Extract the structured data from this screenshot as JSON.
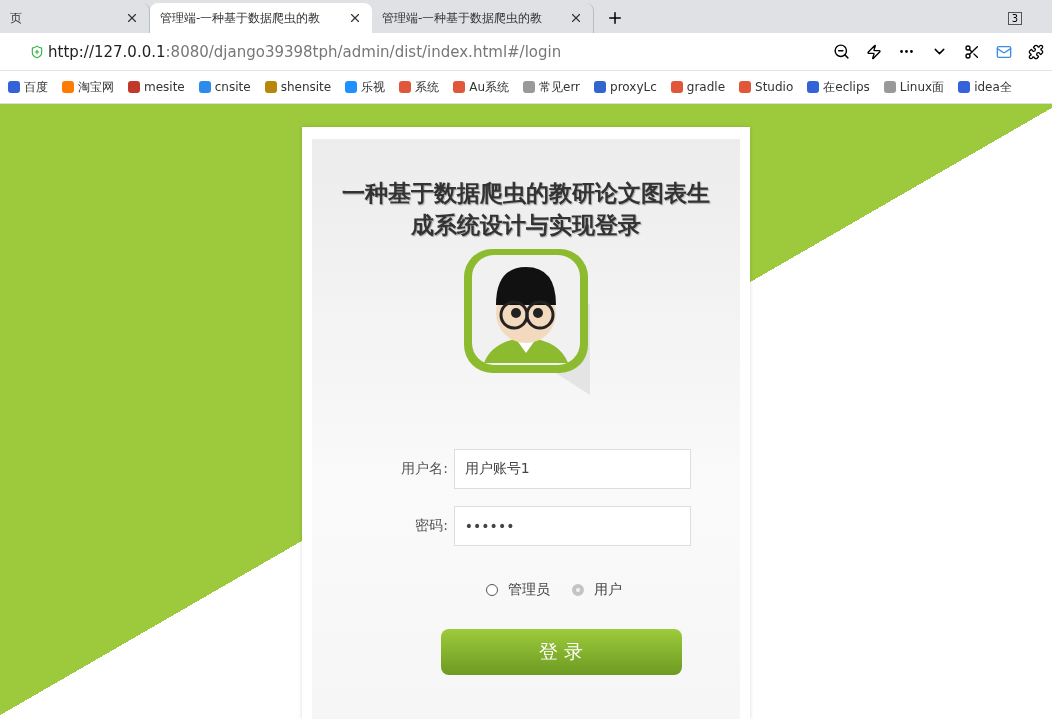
{
  "browser": {
    "tabs": [
      {
        "title": "页",
        "selected": false
      },
      {
        "title": "管理端-一种基于数据爬虫的教",
        "selected": true
      },
      {
        "title": "管理端-一种基于数据爬虫的教",
        "selected": false
      }
    ],
    "tab_count": "3",
    "url_host": "http://127.0.0.1",
    "url_rest": ":8080/django39398tph/admin/dist/index.html#/login",
    "bookmarks": [
      "百度",
      "淘宝网",
      "mesite",
      "cnsite",
      "shensite",
      "乐视",
      "系统",
      "Au系统",
      "常见err",
      "proxyLc",
      "gradle",
      "Studio",
      "在eclips",
      "Linux面",
      "idea全"
    ]
  },
  "login": {
    "title": "一种基于数据爬虫的教研论文图表生成系统设计与实现登录",
    "fields": [
      {
        "label": "用户名:",
        "value": "用户账号1"
      },
      {
        "label": "密码:",
        "value": "••••••"
      }
    ],
    "roles": [
      {
        "label": "管理员",
        "selected": false
      },
      {
        "label": "用户",
        "selected": true
      }
    ],
    "submit": "登 录"
  }
}
